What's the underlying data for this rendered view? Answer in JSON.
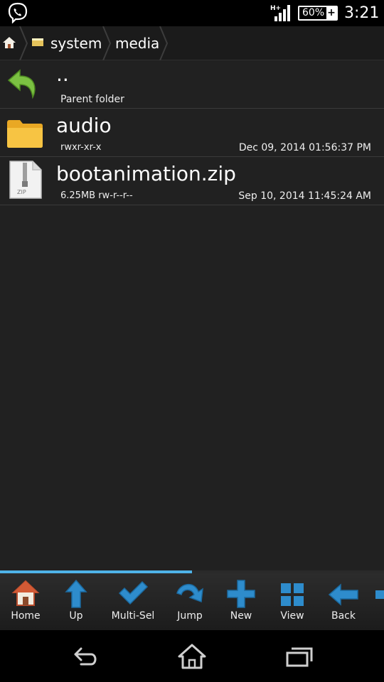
{
  "status_bar": {
    "network": "H+",
    "battery_percent": "60%",
    "time": "3:21",
    "icons": [
      "viber-icon",
      "signal-icon",
      "battery-icon"
    ]
  },
  "breadcrumb": {
    "items": [
      {
        "label": "",
        "icon": "home-icon"
      },
      {
        "label": "system",
        "icon": "sd-card-icon"
      },
      {
        "label": "media",
        "icon": ""
      }
    ]
  },
  "files": [
    {
      "name": "..",
      "sub": "Parent folder",
      "date": "",
      "icon": "back-arrow-icon"
    },
    {
      "name": "audio",
      "sub": "rwxr-xr-x",
      "date": "Dec 09, 2014 01:56:37 PM",
      "icon": "folder-icon"
    },
    {
      "name": "bootanimation.zip",
      "sub": "6.25MB rw-r--r--",
      "date": "Sep 10, 2014 11:45:24 AM",
      "icon": "zip-file-icon"
    }
  ],
  "toolbar": {
    "scroll_fraction": 0.5,
    "buttons": [
      {
        "label": "Home",
        "icon": "home-icon"
      },
      {
        "label": "Up",
        "icon": "up-arrow-icon"
      },
      {
        "label": "Multi-Sel",
        "icon": "checkmark-icon"
      },
      {
        "label": "Jump",
        "icon": "jump-arrow-icon"
      },
      {
        "label": "New",
        "icon": "plus-icon"
      },
      {
        "label": "View",
        "icon": "grid-icon"
      },
      {
        "label": "Back",
        "icon": "left-arrow-icon"
      }
    ]
  },
  "nav_bar": {
    "buttons": [
      "back-icon",
      "home-icon",
      "recents-icon"
    ]
  },
  "colors": {
    "accent": "#4fb3e8",
    "background": "#212121",
    "folder": "#f5b731",
    "arrow_green": "#7bc142"
  }
}
